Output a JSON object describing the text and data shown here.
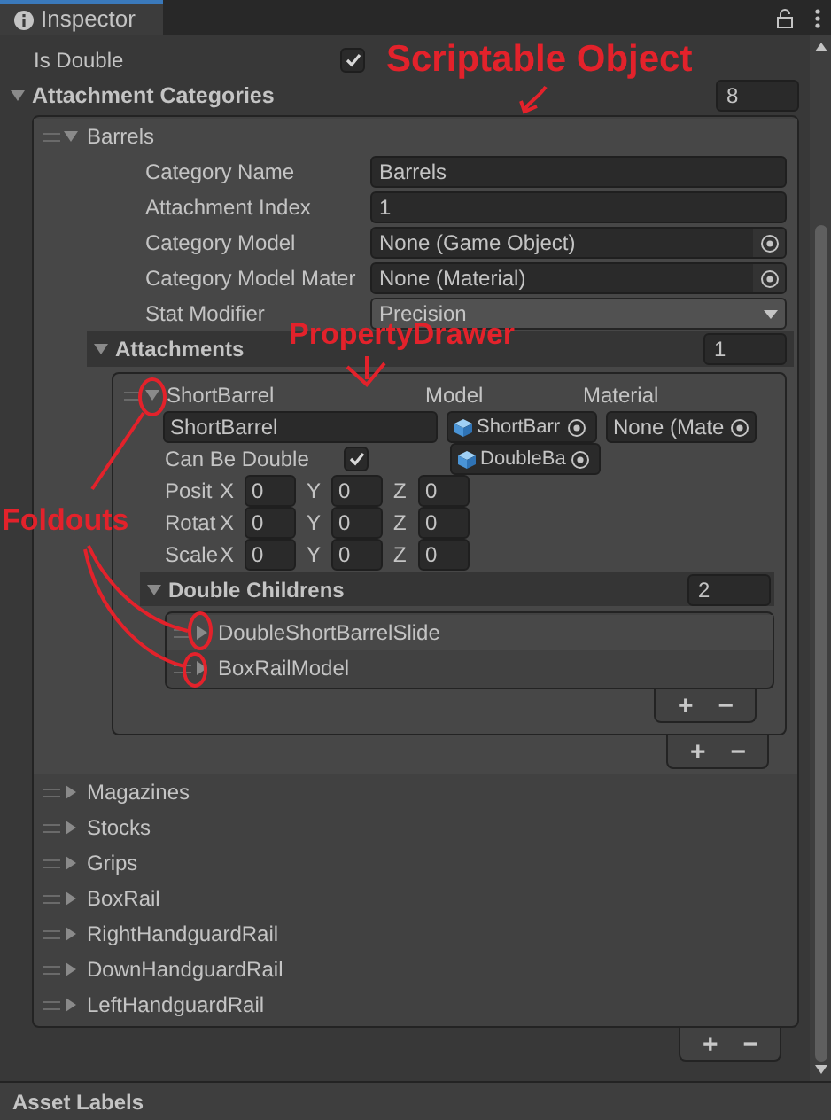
{
  "tab": {
    "title": "Inspector"
  },
  "is_double": {
    "label": "Is Double",
    "checked": true
  },
  "categories": {
    "label": "Attachment Categories",
    "expanded": true,
    "count": "8",
    "footer": [
      "+",
      "−"
    ],
    "items": [
      {
        "name": "Barrels",
        "expanded": true,
        "fields": [
          {
            "kind": "text",
            "label": "Category Name",
            "value": "Barrels"
          },
          {
            "kind": "text",
            "label": "Attachment Index",
            "value": "1"
          },
          {
            "kind": "object",
            "label": "Category Model",
            "value": "None (Game Object)"
          },
          {
            "kind": "object",
            "label": "Category Model Mater",
            "value": "None (Material)"
          },
          {
            "kind": "dropdown",
            "label": "Stat Modifier",
            "value": "Precision"
          }
        ],
        "attachments": {
          "label": "Attachments",
          "expanded": true,
          "count": "1",
          "footer": [
            "+",
            "−"
          ],
          "items": [
            {
              "name": "ShortBarrel",
              "expanded": true,
              "name_value": "ShortBarrel",
              "model_label": "Model",
              "material_label": "Material",
              "models": [
                "ShortBarr",
                "DoubleBa"
              ],
              "material": "None (Mate",
              "can_be_double": {
                "label": "Can Be Double",
                "checked": true
              },
              "vectors": [
                {
                  "label": "Posit",
                  "components": [
                    {
                      "axis": "X",
                      "value": "0"
                    },
                    {
                      "axis": "Y",
                      "value": "0"
                    },
                    {
                      "axis": "Z",
                      "value": "0"
                    }
                  ]
                },
                {
                  "label": "Rotat",
                  "components": [
                    {
                      "axis": "X",
                      "value": "0"
                    },
                    {
                      "axis": "Y",
                      "value": "0"
                    },
                    {
                      "axis": "Z",
                      "value": "0"
                    }
                  ]
                },
                {
                  "label": "Scale",
                  "components": [
                    {
                      "axis": "X",
                      "value": "0"
                    },
                    {
                      "axis": "Y",
                      "value": "0"
                    },
                    {
                      "axis": "Z",
                      "value": "0"
                    }
                  ]
                }
              ],
              "double_childrens": {
                "label": "Double Childrens",
                "expanded": true,
                "count": "2",
                "footer": [
                  "+",
                  "−"
                ],
                "items": [
                  {
                    "name": "DoubleShortBarrelSlide",
                    "expanded": false
                  },
                  {
                    "name": "BoxRailModel",
                    "expanded": false
                  }
                ]
              }
            }
          ]
        }
      },
      {
        "name": "Magazines",
        "expanded": false
      },
      {
        "name": "Stocks",
        "expanded": false
      },
      {
        "name": "Grips",
        "expanded": false
      },
      {
        "name": "BoxRail",
        "expanded": false
      },
      {
        "name": "RightHandguardRail",
        "expanded": false
      },
      {
        "name": "DownHandguardRail",
        "expanded": false
      },
      {
        "name": "LeftHandguardRail",
        "expanded": false
      }
    ]
  },
  "section": {
    "title": "Asset Labels"
  },
  "annotations": [
    {
      "text": "Scriptable Object"
    },
    {
      "text": "PropertyDrawer"
    },
    {
      "text": "Foldouts"
    }
  ]
}
